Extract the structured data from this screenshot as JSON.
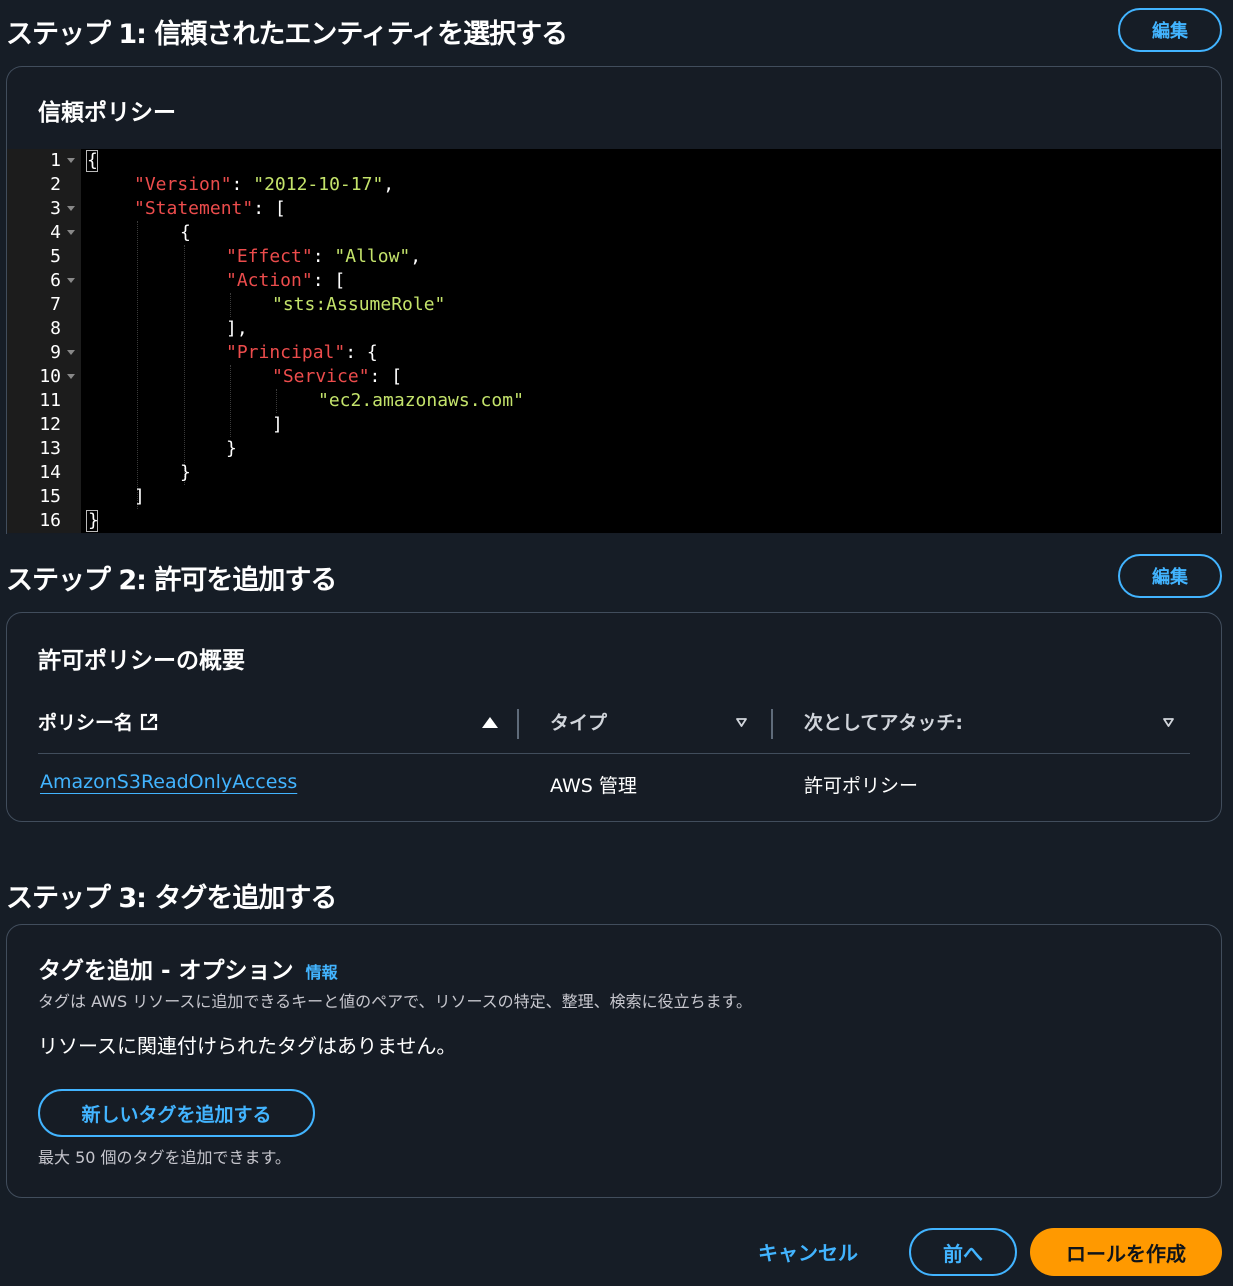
{
  "step1": {
    "title": "ステップ 1: 信頼されたエンティティを選択する",
    "edit_label": "編集",
    "card_title": "信頼ポリシー",
    "code_lines": [
      {
        "n": "1",
        "fold": true
      },
      {
        "n": "2",
        "fold": false
      },
      {
        "n": "3",
        "fold": true
      },
      {
        "n": "4",
        "fold": true
      },
      {
        "n": "5",
        "fold": false
      },
      {
        "n": "6",
        "fold": true
      },
      {
        "n": "7",
        "fold": false
      },
      {
        "n": "8",
        "fold": false
      },
      {
        "n": "9",
        "fold": true
      },
      {
        "n": "10",
        "fold": true
      },
      {
        "n": "11",
        "fold": false
      },
      {
        "n": "12",
        "fold": false
      },
      {
        "n": "13",
        "fold": false
      },
      {
        "n": "14",
        "fold": false
      },
      {
        "n": "15",
        "fold": false
      },
      {
        "n": "16",
        "fold": false
      }
    ],
    "code": {
      "l1": "{",
      "l2_key": "\"Version\"",
      "l2_sep": ": ",
      "l2_val": "\"2012-10-17\"",
      "l2_end": ",",
      "l3_key": "\"Statement\"",
      "l3_end": ": [",
      "l4": "{",
      "l5_key": "\"Effect\"",
      "l5_sep": ": ",
      "l5_val": "\"Allow\"",
      "l5_end": ",",
      "l6_key": "\"Action\"",
      "l6_end": ": [",
      "l7_val": "\"sts:AssumeRole\"",
      "l8": "],",
      "l9_key": "\"Principal\"",
      "l9_end": ": {",
      "l10_key": "\"Service\"",
      "l10_end": ": [",
      "l11_val": "\"ec2.amazonaws.com\"",
      "l12": "]",
      "l13": "}",
      "l14": "}",
      "l15": "]",
      "l16": "}"
    }
  },
  "step2": {
    "title": "ステップ 2: 許可を追加する",
    "edit_label": "編集",
    "card_title": "許可ポリシーの概要",
    "columns": {
      "policy_name": "ポリシー名",
      "type": "タイプ",
      "attached_as": "次としてアタッチ:"
    },
    "rows": [
      {
        "policy_name": "AmazonS3ReadOnlyAccess",
        "type": "AWS 管理",
        "attached_as": "許可ポリシー"
      }
    ]
  },
  "step3": {
    "title": "ステップ 3: タグを追加する",
    "card_title": "タグを追加 - オプション",
    "info_label": "情報",
    "description": "タグは AWS リソースに追加できるキーと値のペアで、リソースの特定、整理、検索に役立ちます。",
    "empty_text": "リソースに関連付けられたタグはありません。",
    "add_tag_label": "新しいタグを追加する",
    "limit_text": "最大 50 個のタグを追加できます。"
  },
  "footer": {
    "cancel_label": "キャンセル",
    "previous_label": "前へ",
    "create_label": "ロールを作成"
  },
  "colors": {
    "background": "#161d26",
    "link": "#42b4ff",
    "primary": "#ff9900",
    "json_key": "#ec4c4c",
    "json_string": "#c4e36b"
  }
}
